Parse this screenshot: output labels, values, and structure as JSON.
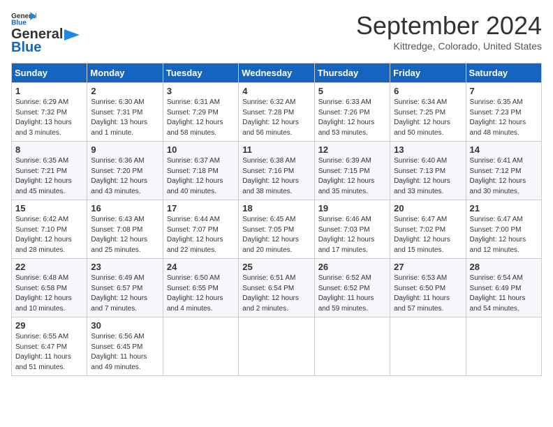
{
  "header": {
    "logo_line1": "General",
    "logo_line2": "Blue",
    "month": "September 2024",
    "location": "Kittredge, Colorado, United States"
  },
  "days_of_week": [
    "Sunday",
    "Monday",
    "Tuesday",
    "Wednesday",
    "Thursday",
    "Friday",
    "Saturday"
  ],
  "weeks": [
    [
      {
        "num": "1",
        "rise": "6:29 AM",
        "set": "7:32 PM",
        "daylight": "13 hours and 3 minutes."
      },
      {
        "num": "2",
        "rise": "6:30 AM",
        "set": "7:31 PM",
        "daylight": "13 hours and 1 minute."
      },
      {
        "num": "3",
        "rise": "6:31 AM",
        "set": "7:29 PM",
        "daylight": "12 hours and 58 minutes."
      },
      {
        "num": "4",
        "rise": "6:32 AM",
        "set": "7:28 PM",
        "daylight": "12 hours and 56 minutes."
      },
      {
        "num": "5",
        "rise": "6:33 AM",
        "set": "7:26 PM",
        "daylight": "12 hours and 53 minutes."
      },
      {
        "num": "6",
        "rise": "6:34 AM",
        "set": "7:25 PM",
        "daylight": "12 hours and 50 minutes."
      },
      {
        "num": "7",
        "rise": "6:35 AM",
        "set": "7:23 PM",
        "daylight": "12 hours and 48 minutes."
      }
    ],
    [
      {
        "num": "8",
        "rise": "6:35 AM",
        "set": "7:21 PM",
        "daylight": "12 hours and 45 minutes."
      },
      {
        "num": "9",
        "rise": "6:36 AM",
        "set": "7:20 PM",
        "daylight": "12 hours and 43 minutes."
      },
      {
        "num": "10",
        "rise": "6:37 AM",
        "set": "7:18 PM",
        "daylight": "12 hours and 40 minutes."
      },
      {
        "num": "11",
        "rise": "6:38 AM",
        "set": "7:16 PM",
        "daylight": "12 hours and 38 minutes."
      },
      {
        "num": "12",
        "rise": "6:39 AM",
        "set": "7:15 PM",
        "daylight": "12 hours and 35 minutes."
      },
      {
        "num": "13",
        "rise": "6:40 AM",
        "set": "7:13 PM",
        "daylight": "12 hours and 33 minutes."
      },
      {
        "num": "14",
        "rise": "6:41 AM",
        "set": "7:12 PM",
        "daylight": "12 hours and 30 minutes."
      }
    ],
    [
      {
        "num": "15",
        "rise": "6:42 AM",
        "set": "7:10 PM",
        "daylight": "12 hours and 28 minutes."
      },
      {
        "num": "16",
        "rise": "6:43 AM",
        "set": "7:08 PM",
        "daylight": "12 hours and 25 minutes."
      },
      {
        "num": "17",
        "rise": "6:44 AM",
        "set": "7:07 PM",
        "daylight": "12 hours and 22 minutes."
      },
      {
        "num": "18",
        "rise": "6:45 AM",
        "set": "7:05 PM",
        "daylight": "12 hours and 20 minutes."
      },
      {
        "num": "19",
        "rise": "6:46 AM",
        "set": "7:03 PM",
        "daylight": "12 hours and 17 minutes."
      },
      {
        "num": "20",
        "rise": "6:47 AM",
        "set": "7:02 PM",
        "daylight": "12 hours and 15 minutes."
      },
      {
        "num": "21",
        "rise": "6:47 AM",
        "set": "7:00 PM",
        "daylight": "12 hours and 12 minutes."
      }
    ],
    [
      {
        "num": "22",
        "rise": "6:48 AM",
        "set": "6:58 PM",
        "daylight": "12 hours and 10 minutes."
      },
      {
        "num": "23",
        "rise": "6:49 AM",
        "set": "6:57 PM",
        "daylight": "12 hours and 7 minutes."
      },
      {
        "num": "24",
        "rise": "6:50 AM",
        "set": "6:55 PM",
        "daylight": "12 hours and 4 minutes."
      },
      {
        "num": "25",
        "rise": "6:51 AM",
        "set": "6:54 PM",
        "daylight": "12 hours and 2 minutes."
      },
      {
        "num": "26",
        "rise": "6:52 AM",
        "set": "6:52 PM",
        "daylight": "11 hours and 59 minutes."
      },
      {
        "num": "27",
        "rise": "6:53 AM",
        "set": "6:50 PM",
        "daylight": "11 hours and 57 minutes."
      },
      {
        "num": "28",
        "rise": "6:54 AM",
        "set": "6:49 PM",
        "daylight": "11 hours and 54 minutes."
      }
    ],
    [
      {
        "num": "29",
        "rise": "6:55 AM",
        "set": "6:47 PM",
        "daylight": "11 hours and 51 minutes."
      },
      {
        "num": "30",
        "rise": "6:56 AM",
        "set": "6:45 PM",
        "daylight": "11 hours and 49 minutes."
      },
      null,
      null,
      null,
      null,
      null
    ]
  ]
}
